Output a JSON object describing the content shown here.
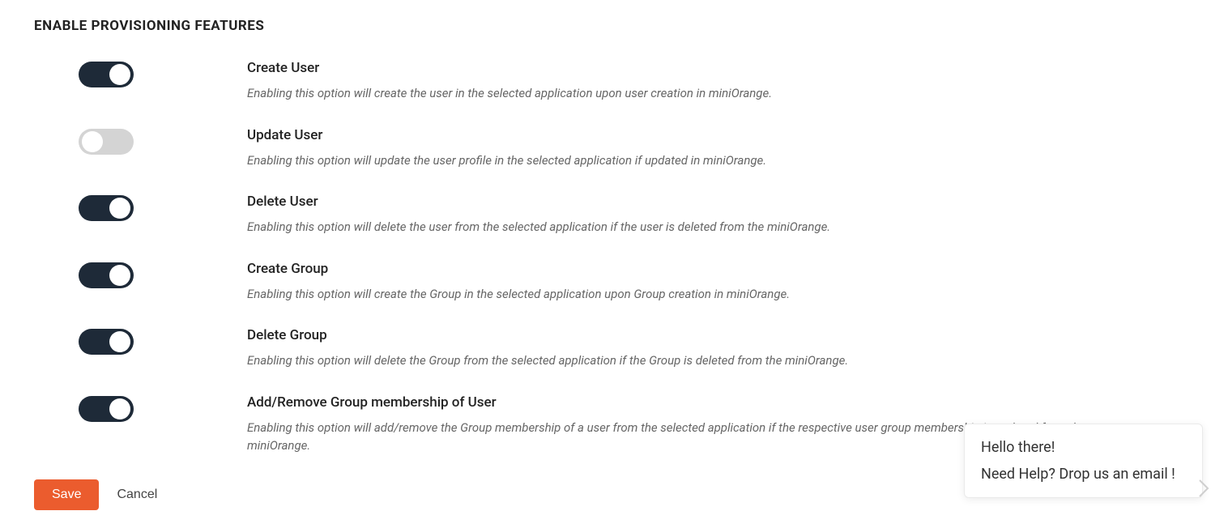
{
  "section_title": "ENABLE PROVISIONING FEATURES",
  "features": [
    {
      "title": "Create User",
      "desc": "Enabling this option will create the user in the selected application upon user creation in miniOrange.",
      "on": true
    },
    {
      "title": "Update User",
      "desc": "Enabling this option will update the user profile in the selected application if updated in miniOrange.",
      "on": false
    },
    {
      "title": "Delete User",
      "desc": "Enabling this option will delete the user from the selected application if the user is deleted from the miniOrange.",
      "on": true
    },
    {
      "title": "Create Group",
      "desc": "Enabling this option will create the Group in the selected application upon Group creation in miniOrange.",
      "on": true
    },
    {
      "title": "Delete Group",
      "desc": "Enabling this option will delete the Group from the selected application if the Group is deleted from the miniOrange.",
      "on": true
    },
    {
      "title": "Add/Remove Group membership of User",
      "desc": "Enabling this option will add/remove the Group membership of a user from the selected application if the respective user group membership is updated from the miniOrange.",
      "on": true
    }
  ],
  "actions": {
    "save": "Save",
    "cancel": "Cancel"
  },
  "chat": {
    "line1": "Hello there!",
    "line2": "Need Help? Drop us an email !"
  }
}
